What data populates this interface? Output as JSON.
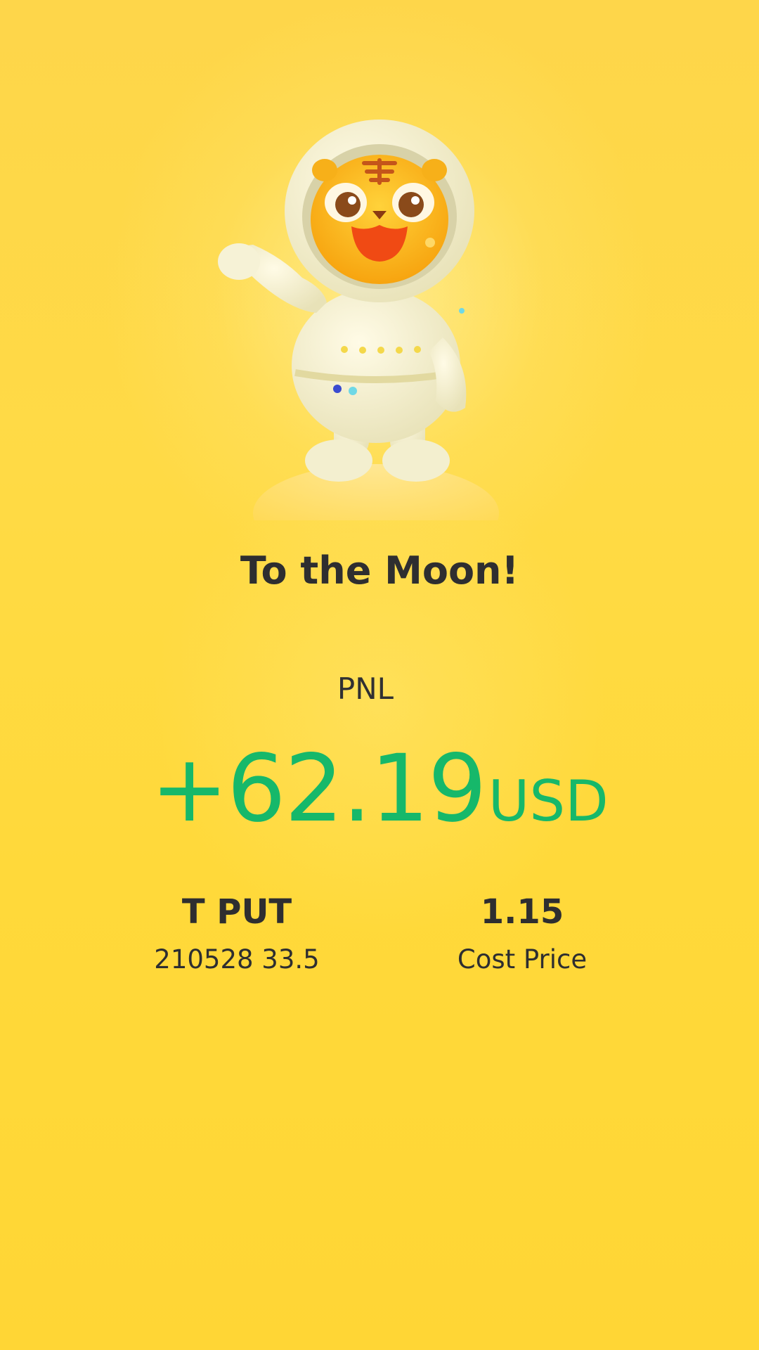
{
  "card": {
    "headline": "To the Moon!",
    "pnl_label": "PNL",
    "pnl_value": "+62.19",
    "pnl_unit": "USD"
  },
  "position": {
    "name": "T PUT",
    "contract": "210528 33.5"
  },
  "cost": {
    "value": "1.15",
    "label": "Cost Price"
  },
  "mascot": {
    "icon": "tiger-astronaut-mascot"
  },
  "colors": {
    "background": "#ffd93a",
    "profit_green": "#16b86a",
    "text_dark": "#2e2e30"
  }
}
